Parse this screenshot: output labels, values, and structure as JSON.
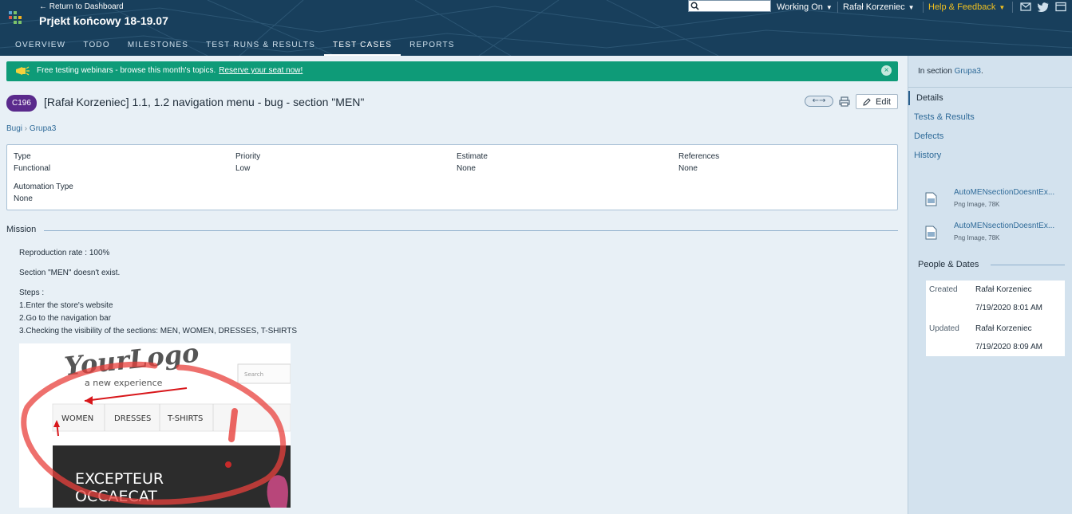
{
  "header": {
    "back_link": "← Return to Dashboard",
    "project_title": "Prjekt końcowy 18-19.07",
    "tabs": [
      {
        "label": "Overview"
      },
      {
        "label": "Todo"
      },
      {
        "label": "Milestones"
      },
      {
        "label": "Test Runs & Results"
      },
      {
        "label": "Test Cases"
      },
      {
        "label": "Reports"
      }
    ],
    "active_tab": "Test Cases",
    "search_placeholder": "",
    "working_on": "Working On",
    "user": "Rafał Korzeniec",
    "help": "Help & Feedback",
    "icons": [
      "mail-icon",
      "twitter-icon",
      "window-icon"
    ]
  },
  "banner": {
    "text": "Free testing webinars - browse this month's topics.",
    "link": "Reserve your seat now!"
  },
  "test_case": {
    "id": "C196",
    "title": "[Rafał Korzeniec] 1.1, 1.2 navigation menu - bug - section \"MEN\"",
    "nav_arrows": "←→",
    "edit_label": "Edit"
  },
  "breadcrumb": {
    "root": "Bugi",
    "separator": "›",
    "section": "Grupa3"
  },
  "properties": {
    "type_label": "Type",
    "type_value": "Functional",
    "priority_label": "Priority",
    "priority_value": "Low",
    "estimate_label": "Estimate",
    "estimate_value": "None",
    "references_label": "References",
    "references_value": "None",
    "automation_label": "Automation Type",
    "automation_value": "None"
  },
  "mission": {
    "heading": "Mission",
    "lines": [
      "Reproduction rate : 100%",
      "Section \"MEN\" doesn't exist.",
      "Steps :",
      "1.Enter the store's website",
      "2.Go to the navigation bar",
      "3.Checking the visibility of the sections: MEN, WOMEN, DRESSES, T-SHIRTS"
    ]
  },
  "screenshot": {
    "logo_main": "YourLogo",
    "logo_sub": "a new experience",
    "search_placeholder": "Search",
    "menu": [
      "WOMEN",
      "DRESSES",
      "T-SHIRTS"
    ],
    "banner_line1": "EXCEPTEUR",
    "banner_line2": "OCCAECAT"
  },
  "sidebar": {
    "in_section_label": "In section",
    "in_section_value": "Grupa3",
    "nav": [
      "Details",
      "Tests & Results",
      "Defects",
      "History"
    ],
    "active_nav": "Details",
    "attachments": [
      {
        "name": "AutoMENsectionDoesntEx...",
        "meta": "Png Image, 78K"
      },
      {
        "name": "AutoMENsectionDoesntEx...",
        "meta": "Png Image, 78K"
      }
    ],
    "people_heading": "People & Dates",
    "created_label": "Created",
    "created_by": "Rafał Korzeniec",
    "created_date": "7/19/2020 8:01 AM",
    "updated_label": "Updated",
    "updated_by": "Rafał Korzeniec",
    "updated_date": "7/19/2020 8:09 AM"
  },
  "colors": {
    "header_bg": "#183f5c",
    "banner_bg": "#0e9b78",
    "case_badge": "#5a2a8c",
    "link": "#2f6b99",
    "help": "#f0c020",
    "annotation_red": "#e8403c"
  }
}
